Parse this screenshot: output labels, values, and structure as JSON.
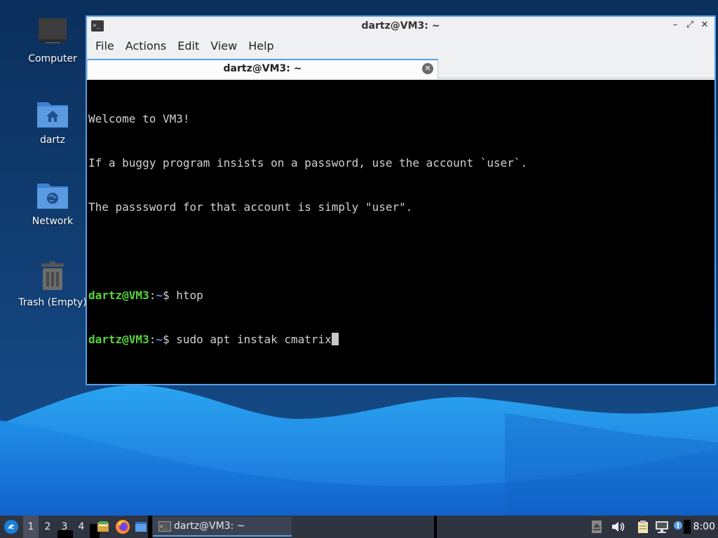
{
  "desktop": {
    "icons": [
      {
        "label": "Computer",
        "icon": "computer-icon"
      },
      {
        "label": "dartz",
        "icon": "home-folder-icon"
      },
      {
        "label": "Network",
        "icon": "network-folder-icon"
      },
      {
        "label": "Trash (Empty)",
        "icon": "trash-icon"
      }
    ]
  },
  "window": {
    "title": "dartz@VM3: ~",
    "menu": [
      "File",
      "Actions",
      "Edit",
      "View",
      "Help"
    ],
    "tab_label": "dartz@VM3: ~",
    "terminal": {
      "lines": [
        "Welcome to VM3!",
        "If a buggy program insists on a password, use the account `user`.",
        "The passsword for that account is simply \"user\"."
      ],
      "prompt_user": "dartz@VM3",
      "prompt_sep": ":",
      "prompt_path": "~",
      "prompt_symbol": "$ ",
      "commands": [
        "htop",
        "sudo apt instak cmatrix"
      ]
    }
  },
  "taskbar": {
    "workspaces": [
      "1",
      "2",
      "3",
      "4"
    ],
    "active_workspace": "1",
    "task_label": "dartz@VM3: ~",
    "clock": "8:00"
  },
  "colors": {
    "accent": "#5b9fe8",
    "prompt_user": "#58d33b",
    "prompt_path": "#5a8fe8",
    "taskbar": "#2e3440"
  }
}
